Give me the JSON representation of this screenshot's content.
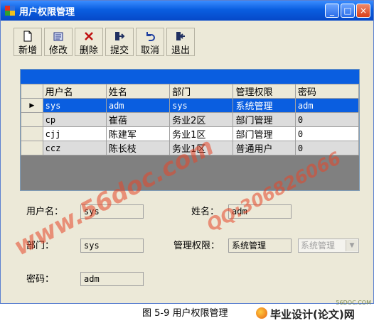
{
  "window": {
    "title": "用户权限管理",
    "minimize": "_",
    "maximize": "□",
    "close": "×"
  },
  "toolbar": {
    "buttons": [
      {
        "label": "新增",
        "icon": "new-document-icon"
      },
      {
        "label": "修改",
        "icon": "edit-icon"
      },
      {
        "label": "删除",
        "icon": "delete-x-icon"
      },
      {
        "label": "提交",
        "icon": "submit-icon"
      },
      {
        "label": "取消",
        "icon": "undo-icon"
      },
      {
        "label": "退出",
        "icon": "exit-icon"
      }
    ]
  },
  "grid": {
    "row_pointer": "▶",
    "columns": [
      "用户名",
      "姓名",
      "部门",
      "管理权限",
      "密码"
    ],
    "rows": [
      [
        "sys",
        "adm",
        "sys",
        "系统管理",
        "adm"
      ],
      [
        "cp",
        "崔蓓",
        "务业2区",
        "部门管理",
        "0"
      ],
      [
        "cjj",
        "陈建军",
        "务业1区",
        "部门管理",
        "0"
      ],
      [
        "ccz",
        "陈长枝",
        "务业1区",
        "普通用户",
        "0"
      ]
    ]
  },
  "form": {
    "username_label": "用户名：",
    "username_value": "sys",
    "name_label": "姓名：",
    "name_value": "adm",
    "dept_label": "部门：",
    "dept_value": "sys",
    "perm_label": "管理权限：",
    "perm_value": "系统管理",
    "perm_select": "系统管理",
    "pwd_label": "密码：",
    "pwd_value": "adm"
  },
  "watermarks": {
    "site": "www.56doc.com",
    "qq": "QQ:306826066"
  },
  "caption": "图 5-9 用户权限管理",
  "brand": {
    "small": "56DOC.COM",
    "text": "毕业设计(论文)网"
  },
  "colors": {
    "titlebar": "#0a5ee0",
    "selection": "#0a5ee0",
    "grid_bg": "#808080",
    "window_bg": "#ece9d8"
  }
}
